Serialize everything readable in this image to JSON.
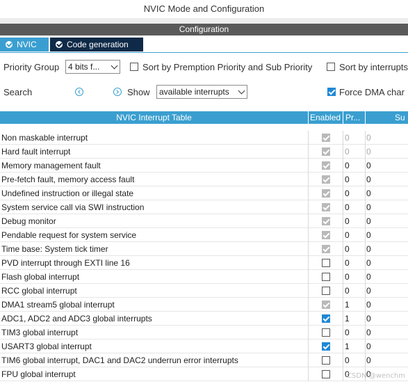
{
  "window": {
    "title": "NVIC Mode and Configuration"
  },
  "config_header": "Configuration",
  "tabs": [
    {
      "label": "NVIC",
      "icon": "check-circle-icon",
      "active": true
    },
    {
      "label": "Code generation",
      "icon": "check-circle-icon",
      "active": false
    }
  ],
  "controls": {
    "priority_group_label": "Priority Group",
    "priority_group_value": "4 bits f...",
    "sort_premption_label": "Sort by Premption Priority and Sub Priority",
    "sort_interrupts_label": "Sort by interrupts",
    "search_label": "Search",
    "show_label": "Show",
    "show_value": "available interrupts",
    "force_dma_label": "Force DMA char",
    "sort_premption_checked": false,
    "sort_interrupts_checked": false,
    "force_dma_checked": true
  },
  "table": {
    "headers": {
      "name": "NVIC Interrupt Table",
      "enabled": "Enabled",
      "preemption": "Pr...",
      "sub": "Su"
    },
    "rows": [
      {
        "name": "Non maskable interrupt",
        "enabled": "forced",
        "pre": "0",
        "sub": "0",
        "muted": true
      },
      {
        "name": "Hard fault interrupt",
        "enabled": "forced",
        "pre": "0",
        "sub": "0",
        "muted": true
      },
      {
        "name": "Memory management fault",
        "enabled": "forced",
        "pre": "0",
        "sub": "0",
        "muted": false
      },
      {
        "name": "Pre-fetch fault, memory access fault",
        "enabled": "forced",
        "pre": "0",
        "sub": "0",
        "muted": false
      },
      {
        "name": "Undefined instruction or illegal state",
        "enabled": "forced",
        "pre": "0",
        "sub": "0",
        "muted": false
      },
      {
        "name": "System service call via SWI instruction",
        "enabled": "forced",
        "pre": "0",
        "sub": "0",
        "muted": false
      },
      {
        "name": "Debug monitor",
        "enabled": "forced",
        "pre": "0",
        "sub": "0",
        "muted": false
      },
      {
        "name": "Pendable request for system service",
        "enabled": "forced",
        "pre": "0",
        "sub": "0",
        "muted": false
      },
      {
        "name": "Time base: System tick timer",
        "enabled": "forced",
        "pre": "0",
        "sub": "0",
        "muted": false
      },
      {
        "name": "PVD interrupt through EXTI line 16",
        "enabled": "off",
        "pre": "0",
        "sub": "0",
        "muted": false
      },
      {
        "name": "Flash global interrupt",
        "enabled": "off",
        "pre": "0",
        "sub": "0",
        "muted": false
      },
      {
        "name": "RCC global interrupt",
        "enabled": "off",
        "pre": "0",
        "sub": "0",
        "muted": false
      },
      {
        "name": "DMA1 stream5 global interrupt",
        "enabled": "forced",
        "pre": "1",
        "sub": "0",
        "muted": false
      },
      {
        "name": "ADC1, ADC2 and ADC3 global interrupts",
        "enabled": "on",
        "pre": "1",
        "sub": "0",
        "muted": false
      },
      {
        "name": "TIM3 global interrupt",
        "enabled": "off",
        "pre": "0",
        "sub": "0",
        "muted": false
      },
      {
        "name": "USART3 global interrupt",
        "enabled": "on",
        "pre": "1",
        "sub": "0",
        "muted": false
      },
      {
        "name": "TIM6 global interrupt, DAC1 and DAC2 underrun error interrupts",
        "enabled": "off",
        "pre": "0",
        "sub": "0",
        "muted": false
      },
      {
        "name": "FPU global interrupt",
        "enabled": "off",
        "pre": "0",
        "sub": "0",
        "muted": false
      }
    ]
  },
  "watermark": "CSDN @wenchm",
  "colors": {
    "accent": "#3a9fd0",
    "tab_dark": "#0f2a48",
    "header_dark": "#5a5a5a",
    "checked_blue": "#1e88d6",
    "checked_grey": "#b9b9b9"
  }
}
